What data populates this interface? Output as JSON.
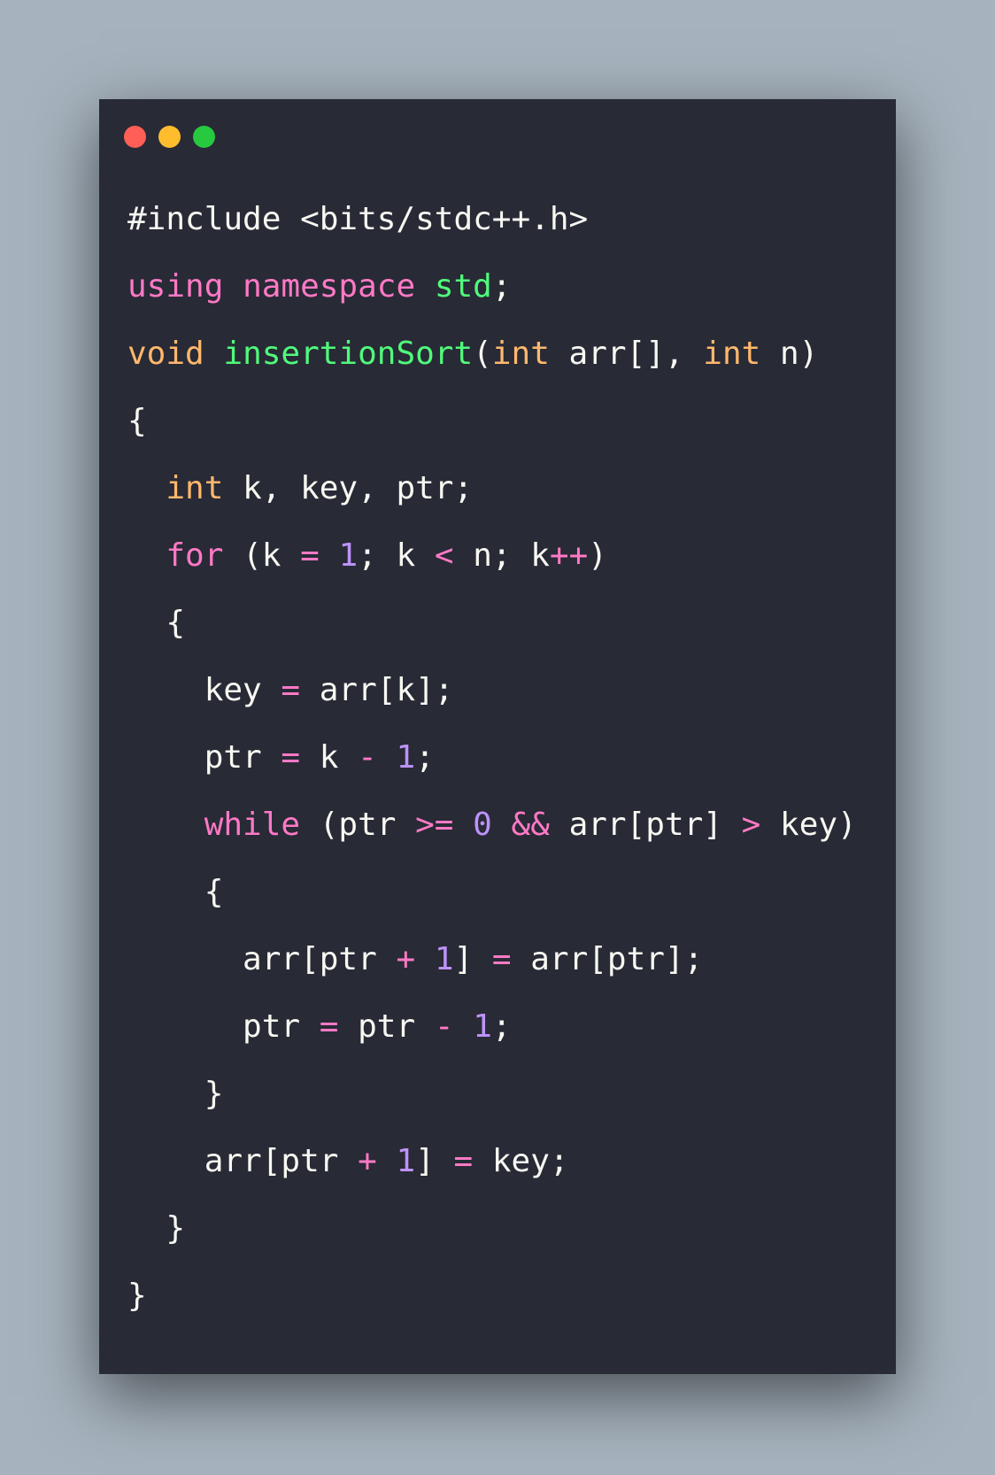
{
  "theme": {
    "background": "#a6b2bd",
    "window_background": "#282a36",
    "default_text": "#f8f8f2",
    "colors": {
      "plain": "#f8f8f2",
      "keyword": "#ff79c6",
      "type": "#ffb86c",
      "function": "#50fa7b",
      "number": "#bd93f9",
      "operator": "#ff79c6"
    }
  },
  "window_controls": [
    {
      "name": "close-dot",
      "color": "#ff5f56"
    },
    {
      "name": "minimize-dot",
      "color": "#ffbd2e"
    },
    {
      "name": "maximize-dot",
      "color": "#27c93f"
    }
  ],
  "code": {
    "language": "C++",
    "lines": [
      [
        {
          "t": "#include <bits/stdc++.h>",
          "c": "plain"
        }
      ],
      [
        {
          "t": "using",
          "c": "keyword"
        },
        {
          "t": " ",
          "c": "plain"
        },
        {
          "t": "namespace",
          "c": "keyword"
        },
        {
          "t": " ",
          "c": "plain"
        },
        {
          "t": "std",
          "c": "function"
        },
        {
          "t": ";",
          "c": "plain"
        }
      ],
      [
        {
          "t": "void",
          "c": "type"
        },
        {
          "t": " ",
          "c": "plain"
        },
        {
          "t": "insertionSort",
          "c": "function"
        },
        {
          "t": "(",
          "c": "plain"
        },
        {
          "t": "int",
          "c": "type"
        },
        {
          "t": " arr[], ",
          "c": "plain"
        },
        {
          "t": "int",
          "c": "type"
        },
        {
          "t": " n)",
          "c": "plain"
        }
      ],
      [
        {
          "t": "{",
          "c": "plain"
        }
      ],
      [
        {
          "t": "  ",
          "c": "plain"
        },
        {
          "t": "int",
          "c": "type"
        },
        {
          "t": " k, key, ptr;",
          "c": "plain"
        }
      ],
      [
        {
          "t": "  ",
          "c": "plain"
        },
        {
          "t": "for",
          "c": "keyword"
        },
        {
          "t": " (k ",
          "c": "plain"
        },
        {
          "t": "=",
          "c": "operator"
        },
        {
          "t": " ",
          "c": "plain"
        },
        {
          "t": "1",
          "c": "number"
        },
        {
          "t": "; k ",
          "c": "plain"
        },
        {
          "t": "<",
          "c": "operator"
        },
        {
          "t": " n; k",
          "c": "plain"
        },
        {
          "t": "++",
          "c": "operator"
        },
        {
          "t": ")",
          "c": "plain"
        }
      ],
      [
        {
          "t": "  {",
          "c": "plain"
        }
      ],
      [
        {
          "t": "    key ",
          "c": "plain"
        },
        {
          "t": "=",
          "c": "operator"
        },
        {
          "t": " arr[k];",
          "c": "plain"
        }
      ],
      [
        {
          "t": "    ptr ",
          "c": "plain"
        },
        {
          "t": "=",
          "c": "operator"
        },
        {
          "t": " k ",
          "c": "plain"
        },
        {
          "t": "-",
          "c": "operator"
        },
        {
          "t": " ",
          "c": "plain"
        },
        {
          "t": "1",
          "c": "number"
        },
        {
          "t": ";",
          "c": "plain"
        }
      ],
      [
        {
          "t": "    ",
          "c": "plain"
        },
        {
          "t": "while",
          "c": "keyword"
        },
        {
          "t": " (ptr ",
          "c": "plain"
        },
        {
          "t": ">=",
          "c": "operator"
        },
        {
          "t": " ",
          "c": "plain"
        },
        {
          "t": "0",
          "c": "number"
        },
        {
          "t": " ",
          "c": "plain"
        },
        {
          "t": "&&",
          "c": "operator"
        },
        {
          "t": " arr[ptr] ",
          "c": "plain"
        },
        {
          "t": ">",
          "c": "operator"
        },
        {
          "t": " key)",
          "c": "plain"
        }
      ],
      [
        {
          "t": "    {",
          "c": "plain"
        }
      ],
      [
        {
          "t": "      arr[ptr ",
          "c": "plain"
        },
        {
          "t": "+",
          "c": "operator"
        },
        {
          "t": " ",
          "c": "plain"
        },
        {
          "t": "1",
          "c": "number"
        },
        {
          "t": "] ",
          "c": "plain"
        },
        {
          "t": "=",
          "c": "operator"
        },
        {
          "t": " arr[ptr];",
          "c": "plain"
        }
      ],
      [
        {
          "t": "      ptr ",
          "c": "plain"
        },
        {
          "t": "=",
          "c": "operator"
        },
        {
          "t": " ptr ",
          "c": "plain"
        },
        {
          "t": "-",
          "c": "operator"
        },
        {
          "t": " ",
          "c": "plain"
        },
        {
          "t": "1",
          "c": "number"
        },
        {
          "t": ";",
          "c": "plain"
        }
      ],
      [
        {
          "t": "    }",
          "c": "plain"
        }
      ],
      [
        {
          "t": "    arr[ptr ",
          "c": "plain"
        },
        {
          "t": "+",
          "c": "operator"
        },
        {
          "t": " ",
          "c": "plain"
        },
        {
          "t": "1",
          "c": "number"
        },
        {
          "t": "] ",
          "c": "plain"
        },
        {
          "t": "=",
          "c": "operator"
        },
        {
          "t": " key;",
          "c": "plain"
        }
      ],
      [
        {
          "t": "  }",
          "c": "plain"
        }
      ],
      [
        {
          "t": "}",
          "c": "plain"
        }
      ]
    ]
  }
}
